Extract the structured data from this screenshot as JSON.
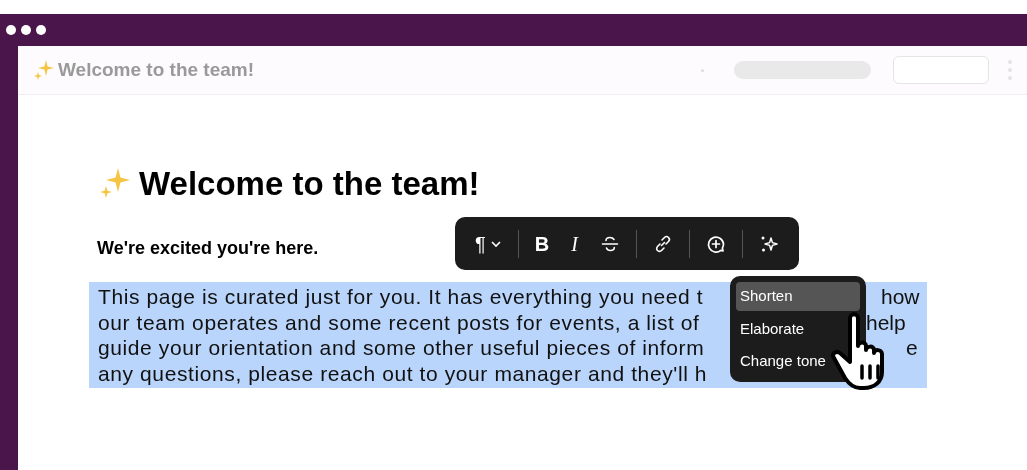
{
  "window": {
    "title": "Welcome to the team!"
  },
  "page": {
    "heading": "Welcome to the team!",
    "subtitle": "We're excited you're here.",
    "paragraph_lines": [
      {
        "left": "This page is curated just for you. It has everything you need t",
        "right": "how"
      },
      {
        "left": "our team operates and some recent posts for events, a list of",
        "right": "help"
      },
      {
        "left": "guide your orientation and some other useful pieces of inform",
        "right": "e"
      },
      {
        "left": "any questions, please reach out to your manager and they'll h"
      }
    ]
  },
  "toolbar": {
    "items": [
      {
        "kind": "paragraph",
        "label": "¶"
      },
      {
        "kind": "bold",
        "label": "B"
      },
      {
        "kind": "italic",
        "label": "I"
      },
      {
        "kind": "strike"
      },
      {
        "kind": "link"
      },
      {
        "kind": "comment"
      },
      {
        "kind": "ai"
      }
    ]
  },
  "ai_menu": {
    "items": [
      {
        "label": "Shorten",
        "selected": true
      },
      {
        "label": "Elaborate",
        "selected": false
      },
      {
        "label": "Change tone",
        "selected": false
      }
    ]
  }
}
